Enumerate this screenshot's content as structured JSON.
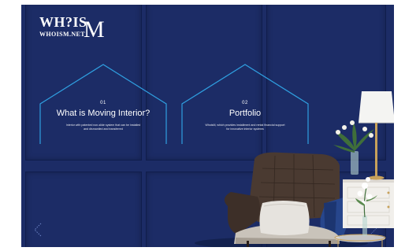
{
  "brand": {
    "name": "WH?IS",
    "domain": "WHOISM.NET",
    "monogram": "M"
  },
  "cards": [
    {
      "number": "01",
      "title": "What is Moving Interior?",
      "description_line1": "Interior with patented non-slide system that can be installed",
      "description_line2": "and dismantled and transferred"
    },
    {
      "number": "02",
      "title": "Portfolio",
      "description_line1": "WhoisM, which provides installment and rental financial support",
      "description_line2": "for innovative interior systems"
    }
  ],
  "colors": {
    "wall": "#1c2c66",
    "card_outline": "#2f9fe0",
    "text": "#ffffff"
  },
  "icons": {
    "prev": "chevron-left-icon"
  }
}
